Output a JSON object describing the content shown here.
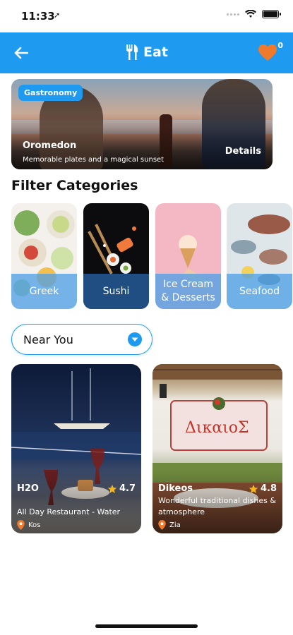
{
  "status_bar": {
    "time": "11:33",
    "location_arrow": "➚"
  },
  "header": {
    "title": "Eat",
    "favorites_count": "0",
    "accent": "#1e9af0"
  },
  "hero": {
    "badge": "Gastronomy",
    "title": "Oromedon",
    "subtitle": "Memorable plates and a magical sunset",
    "details_label": "Details"
  },
  "section": {
    "filter_title": "Filter Categories"
  },
  "categories": [
    {
      "label": "Greek"
    },
    {
      "label": "Sushi"
    },
    {
      "label": "Ice Cream\n& Desserts"
    },
    {
      "label": "Seafood"
    }
  ],
  "filter": {
    "selected": "Near You"
  },
  "restaurants": [
    {
      "name": "H2O",
      "rating": "4.7",
      "description": "All Day Restaurant - Water",
      "location": "Kos"
    },
    {
      "name": "Dikeos",
      "rating": "4.8",
      "description": "Wonderful traditional dishes & atmosphere",
      "location": "Zia"
    }
  ]
}
